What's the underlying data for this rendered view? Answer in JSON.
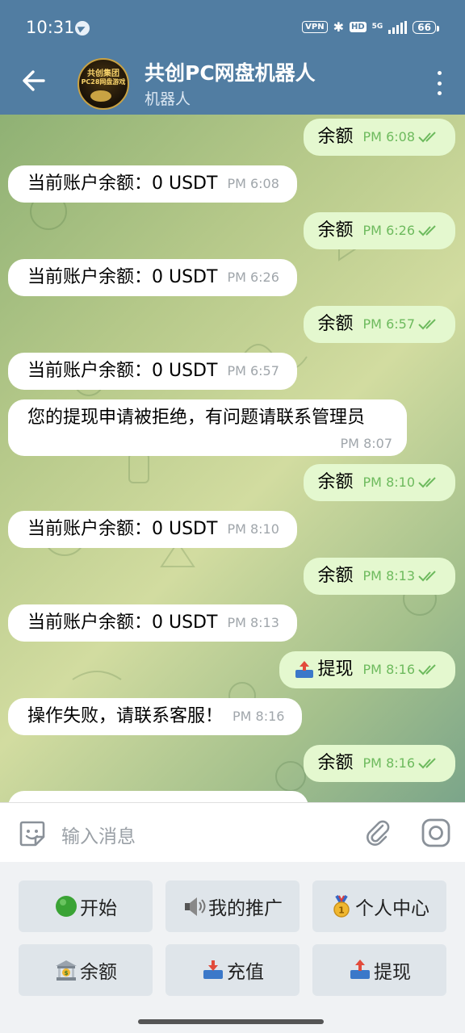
{
  "status_bar": {
    "time": "10:31",
    "vpn": "VPN",
    "hd": "HD",
    "network": "5G",
    "battery": "66"
  },
  "header": {
    "title": "共创PC网盘机器人",
    "subtitle": "机器人",
    "avatar_line1": "共创集团",
    "avatar_line2": "PC28网盘游戏"
  },
  "messages": [
    {
      "dir": "out",
      "text": "余额",
      "time": "PM 6:08"
    },
    {
      "dir": "in",
      "text": "当前账户余额：0 USDT",
      "time": "PM 6:08"
    },
    {
      "dir": "out",
      "text": "余额",
      "time": "PM 6:26"
    },
    {
      "dir": "in",
      "text": "当前账户余额：0 USDT",
      "time": "PM 6:26"
    },
    {
      "dir": "out",
      "text": "余额",
      "time": "PM 6:57"
    },
    {
      "dir": "in",
      "text": "当前账户余额：0 USDT",
      "time": "PM 6:57"
    },
    {
      "dir": "in",
      "text": "您的提现申请被拒绝，有问题请联系管理员",
      "time": "PM 8:07"
    },
    {
      "dir": "out",
      "text": "余额",
      "time": "PM 8:10"
    },
    {
      "dir": "in",
      "text": "当前账户余额：0 USDT",
      "time": "PM 8:10"
    },
    {
      "dir": "out",
      "text": "余额",
      "time": "PM 8:13"
    },
    {
      "dir": "in",
      "text": "当前账户余额：0 USDT",
      "time": "PM 8:13"
    },
    {
      "dir": "out",
      "text": "提现",
      "time": "PM 8:16"
    },
    {
      "dir": "in",
      "text": "操作失败，请联系客服！",
      "time": "PM 8:16"
    },
    {
      "dir": "out",
      "text": "余额",
      "time": "PM 8:16"
    }
  ],
  "input": {
    "placeholder": "输入消息"
  },
  "keyboard": {
    "start": "开始",
    "promo": "我的推广",
    "profile": "个人中心",
    "balance": "余额",
    "deposit": "充值",
    "withdraw": "提现"
  },
  "colors": {
    "header": "#517da2",
    "out_bubble": "#e4f8cf",
    "in_bubble": "#ffffff",
    "check": "#6dba5d"
  }
}
